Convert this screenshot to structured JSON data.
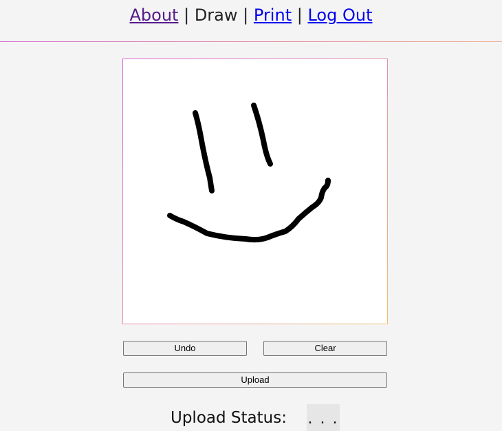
{
  "nav": {
    "about": "About",
    "draw": "Draw",
    "print": "Print",
    "logout": "Log Out",
    "separator": "|"
  },
  "canvas": {
    "stroke_color": "#000000",
    "background": "#ffffff",
    "drawing": "smiley face sketch"
  },
  "buttons": {
    "undo": "Undo",
    "clear": "Clear",
    "upload": "Upload"
  },
  "status": {
    "label": "Upload Status:",
    "value": ". . ."
  },
  "colors": {
    "page_background": "#f4f4f4",
    "link_visited": "#551a8b",
    "link": "#0000ee",
    "accent_gradient_start": "#d96ad2",
    "accent_gradient_end": "#f0b090"
  }
}
